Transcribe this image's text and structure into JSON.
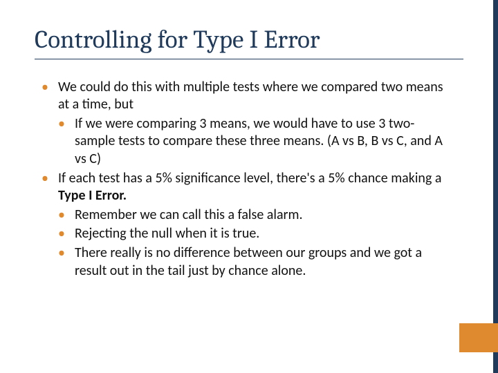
{
  "title": "Controlling for Type I Error",
  "bullets": {
    "b1": "We could do this with multiple tests where we compared two means at a time, but",
    "b1a": "If we were comparing 3 means, we would have to use 3 two-sample tests to compare these three means.  (A vs B, B vs C, and A vs C)",
    "b2_pre": "If each test has a 5% significance level, there's a 5% chance making a ",
    "b2_bold": "Type I Error.",
    "b2a": "Remember we can call this a false alarm.",
    "b2b": "Rejecting the null when it is true.",
    "b2c": "There really is no difference between our groups and we got a result out in the tail just by chance alone."
  }
}
